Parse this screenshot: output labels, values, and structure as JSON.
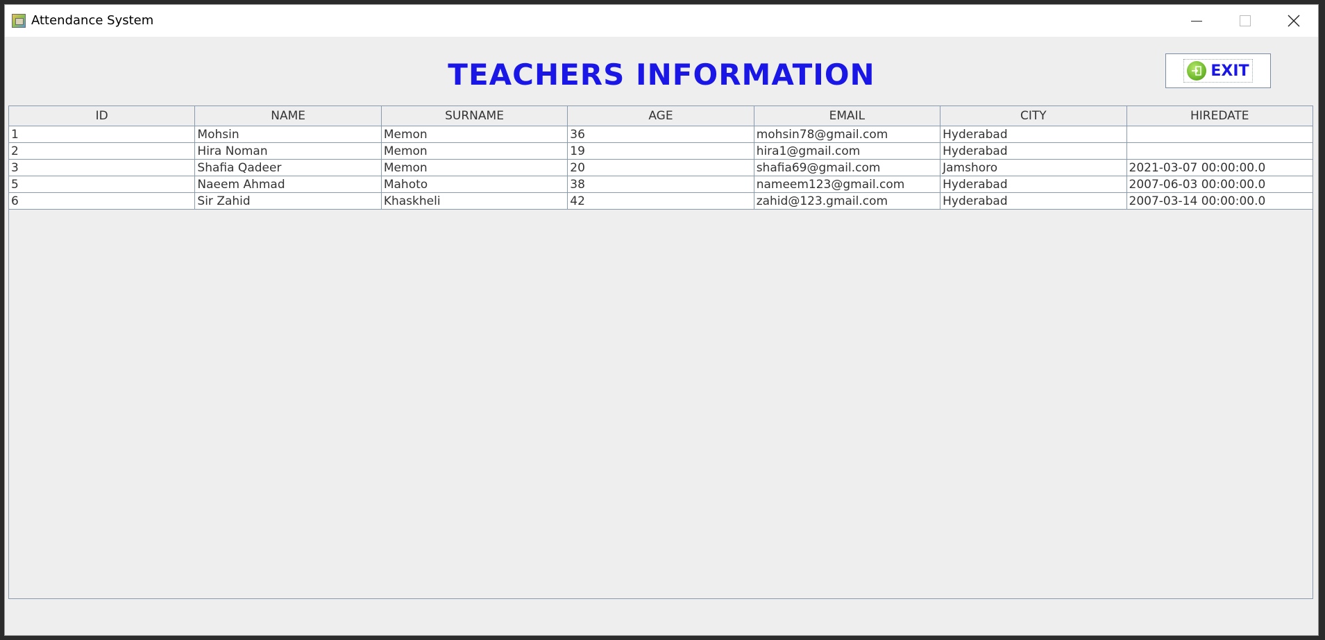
{
  "window": {
    "title": "Attendance System"
  },
  "page": {
    "heading": "TEACHERS INFORMATION",
    "exit_label": "EXIT",
    "exit_icon": "exit-door-icon",
    "heading_color": "#1a17e6"
  },
  "table": {
    "columns": [
      "ID",
      "NAME",
      "SURNAME",
      "AGE",
      "EMAIL",
      "CITY",
      "HIREDATE"
    ],
    "rows": [
      [
        "1",
        "Mohsin",
        "Memon",
        "36",
        "mohsin78@gmail.com",
        "Hyderabad",
        ""
      ],
      [
        "2",
        "Hira Noman",
        "Memon",
        "19",
        "hira1@gmail.com",
        "Hyderabad",
        ""
      ],
      [
        "3",
        "Shafia Qadeer",
        "Memon",
        "20",
        "shafia69@gmail.com",
        "Jamshoro",
        "2021-03-07 00:00:00.0"
      ],
      [
        "5",
        "Naeem Ahmad",
        "Mahoto",
        "38",
        "nameem123@gmail.com",
        "Hyderabad",
        "2007-06-03 00:00:00.0"
      ],
      [
        "6",
        "Sir Zahid",
        "Khaskheli",
        "42",
        "zahid@123.gmail.com",
        "Hyderabad",
        "2007-03-14 00:00:00.0"
      ]
    ]
  }
}
